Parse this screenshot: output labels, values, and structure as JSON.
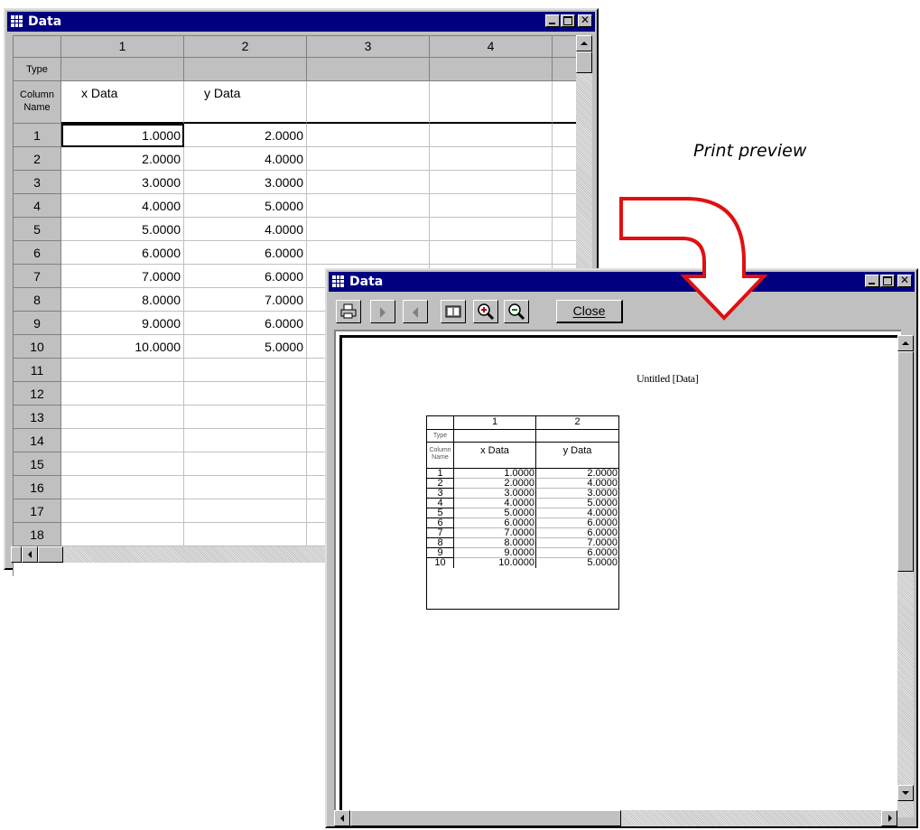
{
  "annotation": "Print preview",
  "main_window": {
    "title": "Data",
    "columns": [
      "1",
      "2",
      "3",
      "4"
    ],
    "type_label": "Type",
    "column_name_label": "Column Name",
    "column_names": [
      "x Data",
      "y Data",
      "",
      ""
    ],
    "row_numbers": [
      "1",
      "2",
      "3",
      "4",
      "5",
      "6",
      "7",
      "8",
      "9",
      "10",
      "11",
      "12",
      "13",
      "14",
      "15",
      "16",
      "17",
      "18"
    ],
    "x_values": [
      "1.0000",
      "2.0000",
      "3.0000",
      "4.0000",
      "5.0000",
      "6.0000",
      "7.0000",
      "8.0000",
      "9.0000",
      "10.0000"
    ],
    "y_values": [
      "2.0000",
      "4.0000",
      "3.0000",
      "5.0000",
      "4.0000",
      "6.0000",
      "6.0000",
      "7.0000",
      "6.0000",
      "5.0000"
    ]
  },
  "preview_window": {
    "title": "Data",
    "close_button": "Close",
    "page_title": "Untitled [Data]",
    "table": {
      "columns": [
        "1",
        "2"
      ],
      "type_label": "Type",
      "column_name_label": "Column Name",
      "column_names": [
        "x Data",
        "y Data"
      ],
      "row_numbers": [
        "1",
        "2",
        "3",
        "4",
        "5",
        "6",
        "7",
        "8",
        "9",
        "10"
      ],
      "x_values": [
        "1.0000",
        "2.0000",
        "3.0000",
        "4.0000",
        "5.0000",
        "6.0000",
        "7.0000",
        "8.0000",
        "9.0000",
        "10.0000"
      ],
      "y_values": [
        "2.0000",
        "4.0000",
        "3.0000",
        "5.0000",
        "4.0000",
        "6.0000",
        "6.0000",
        "7.0000",
        "6.0000",
        "5.0000"
      ]
    }
  },
  "colors": {
    "title_bar": "#000080",
    "window_face": "#c0c0c0",
    "arrow_red": "#e01010"
  }
}
